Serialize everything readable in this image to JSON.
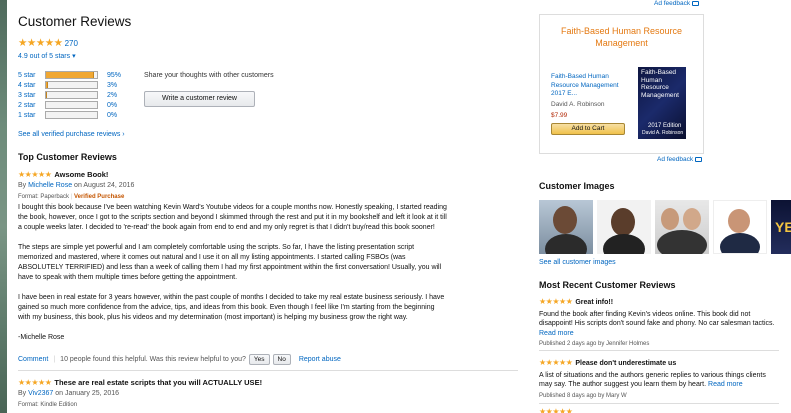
{
  "ad_feedback_top": "Ad feedback",
  "summary": {
    "title": "Customer Reviews",
    "stars": "★★★★★",
    "count": "270",
    "out_of": "4.9 out of 5 stars",
    "histogram": [
      {
        "label": "5 star",
        "percent": "95%",
        "fraction": 0.95
      },
      {
        "label": "4 star",
        "percent": "3%",
        "fraction": 0.03
      },
      {
        "label": "3 star",
        "percent": "2%",
        "fraction": 0.02
      },
      {
        "label": "2 star",
        "percent": "0%",
        "fraction": 0.0
      },
      {
        "label": "1 star",
        "percent": "0%",
        "fraction": 0.0
      }
    ],
    "share_text": "Share your thoughts with other customers",
    "write_button": "Write a customer review",
    "see_all": "See all verified purchase reviews ›"
  },
  "top_reviews": {
    "heading": "Top Customer Reviews",
    "review1": {
      "stars": "★★★★★",
      "title": "Awsome Book!",
      "by": "By",
      "author": "Michelle Rose",
      "date": "on August 24, 2016",
      "format": "Format: Paperback",
      "verified": "Verified Purchase",
      "paragraphs": [
        "I bought this book because I've been watching Kevin Ward's Youtube videos for a couple months now. Honestly speaking, I started reading the book, however, once I got to the scripts section and beyond I skimmed through the rest and put it in my bookshelf and left it look at it till a couple weeks later. I decided to 're-read' the book again from end to end and my only regret is that I didn't buy/read this book sooner!",
        "The steps are simple yet powerful and I am completely comfortable using the scripts. So far, I have the listing presentation script memorized and mastered, where it comes out natural and I use it on all my listing appointments. I started calling FSBOs (was ABSOLUTELY TERRIFIED) and less than a week of calling them I had my first appointment within the first conversation! Usually, you will have to speak with them multiple times before getting the appointment.",
        "I have been in real estate for 3 years however, within the past couple of months I decided to take my real estate business seriously. I have gained so much more confidence from the advice, tips, and ideas from this book. Even though I feel like I'm starting from the beginning with my business, this book, plus his videos and my determination (most important) is helping my business grow the right way.",
        "-Michelle Rose"
      ],
      "comment": "Comment",
      "helpful": "10 people found this helpful. Was this review helpful to you?",
      "yes": "Yes",
      "no": "No",
      "report": "Report abuse"
    },
    "review2": {
      "stars": "★★★★★",
      "title": "These are real estate scripts that you will ACTUALLY USE!",
      "by": "By",
      "author": "Viv2367",
      "date": "on January 25, 2016",
      "format": "Format: Kindle Edition"
    }
  },
  "ad": {
    "title": "Faith-Based Human Resource Management",
    "product_title": "Faith-Based Human Resource Management 2017 E...",
    "author": "David A. Robinson",
    "price": "$7.99",
    "add_to_cart": "Add to Cart",
    "cover_title": "Faith-Based Human Resource Management",
    "cover_edition": "2017 Edition",
    "cover_author": "David A. Robinson",
    "feedback": "Ad feedback"
  },
  "customer_images": {
    "heading": "Customer Images",
    "thumb5_text": "YES",
    "see_all": "See all customer images"
  },
  "recent": {
    "heading": "Most Recent Customer Reviews",
    "items": [
      {
        "stars": "★★★★★",
        "title": "Great info!!",
        "body": "Found the book after finding Kevin's videos online. This book did not disappoint! His scripts don't sound fake and phony. No car salesman tactics.",
        "more": "Read more",
        "published": "Published 2 days ago by Jennifer Holmes"
      },
      {
        "stars": "★★★★★",
        "title": "Please don't underestimate us",
        "body": "A list of situations and the authors generic replies to various things clients may say. The author suggest you learn them by heart.",
        "more": "Read more",
        "published": "Published 8 days ago by Mary W"
      }
    ]
  },
  "colors": {
    "star": "#f5a623",
    "link": "#0066c0",
    "ad_title": "#e47911",
    "price": "#b12704",
    "verified": "#c45500"
  }
}
